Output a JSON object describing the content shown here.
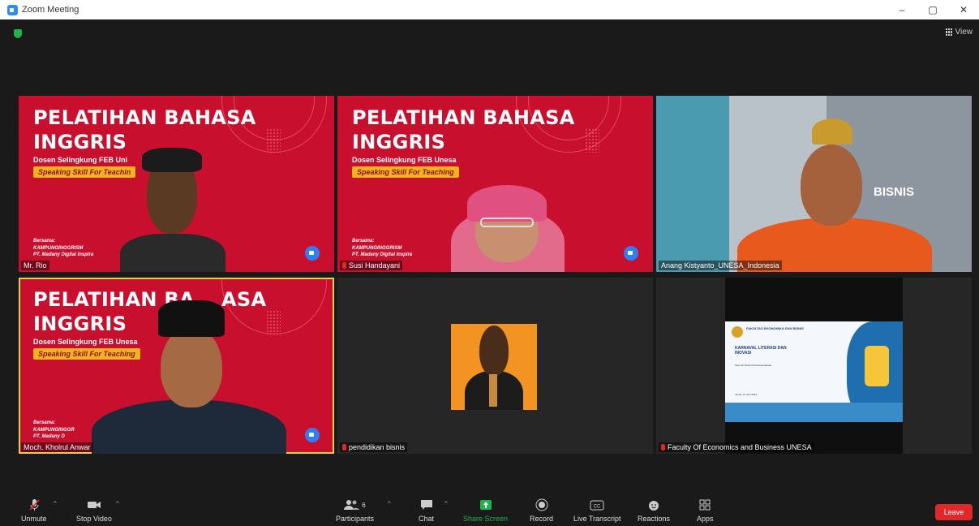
{
  "window": {
    "title": "Zoom Meeting",
    "minimize": "–",
    "maximize": "▢",
    "close": "✕"
  },
  "header": {
    "view_label": "View"
  },
  "tiles": [
    {
      "participant": "Mr. Rio",
      "banner": {
        "title_line1": "PELATIHAN BAHASA",
        "title_line2": "INGGRIS",
        "subtitle": "Dosen Selingkung FEB Uni",
        "pill": "Speaking Skill For Teachin",
        "foot1": "Bersama:",
        "foot2": "KAMPUNGINGGRISM",
        "foot3": "PT. Madany Digital Inspira"
      }
    },
    {
      "participant": "Susi Handayani",
      "banner": {
        "title_line1": "PELATIHAN BAHASA",
        "title_line2": "INGGRIS",
        "subtitle": "Dosen Selingkung FEB Unesa",
        "pill": "Speaking Skill For Teaching",
        "foot1": "Bersama:",
        "foot2": "KAMPUNGINGGRISM",
        "foot3": "PT. Madany Digital Inspira"
      }
    },
    {
      "participant": "Anang Kistyanto_UNESA_Indonesia",
      "wall_text": "BISNIS"
    },
    {
      "participant": "Moch. Kholrul Anwar",
      "banner": {
        "title_line1a": "PELATIHAN BA",
        "title_line1b": "ASA",
        "title_line2": "INGGRIS",
        "subtitle": "Dosen Selingkung FEB Unesa",
        "pill": "Speaking Skill For Teaching",
        "foot1": "Bersama:",
        "foot2": "KAMPUNGINGGR",
        "foot3": "PT. Madany D"
      }
    },
    {
      "participant": "pendidikan bisnis"
    },
    {
      "participant": "Faculty Of Economics and Business UNESA",
      "poster": {
        "header": "FAKULTAS EKONOMIKA DAN BISNIS",
        "title": "KARNAVAL LITERASI DAN INOVASI",
        "line1": "Seminar Nasional Kewirausahaan",
        "line2": "Jumat, 21 Juni 2023"
      }
    }
  ],
  "toolbar": {
    "unmute": "Unmute",
    "stop_video": "Stop Video",
    "participants": "Participants",
    "participants_count": "6",
    "chat": "Chat",
    "share_screen": "Share Screen",
    "record": "Record",
    "live_transcript": "Live Transcript",
    "reactions": "Reactions",
    "apps": "Apps",
    "leave": "Leave"
  },
  "colors": {
    "banner_red": "#c8102e",
    "pill_yellow": "#f2b31b",
    "share_green": "#22b14c",
    "leave_red": "#e02828",
    "active_speaker": "#e6d23a"
  }
}
